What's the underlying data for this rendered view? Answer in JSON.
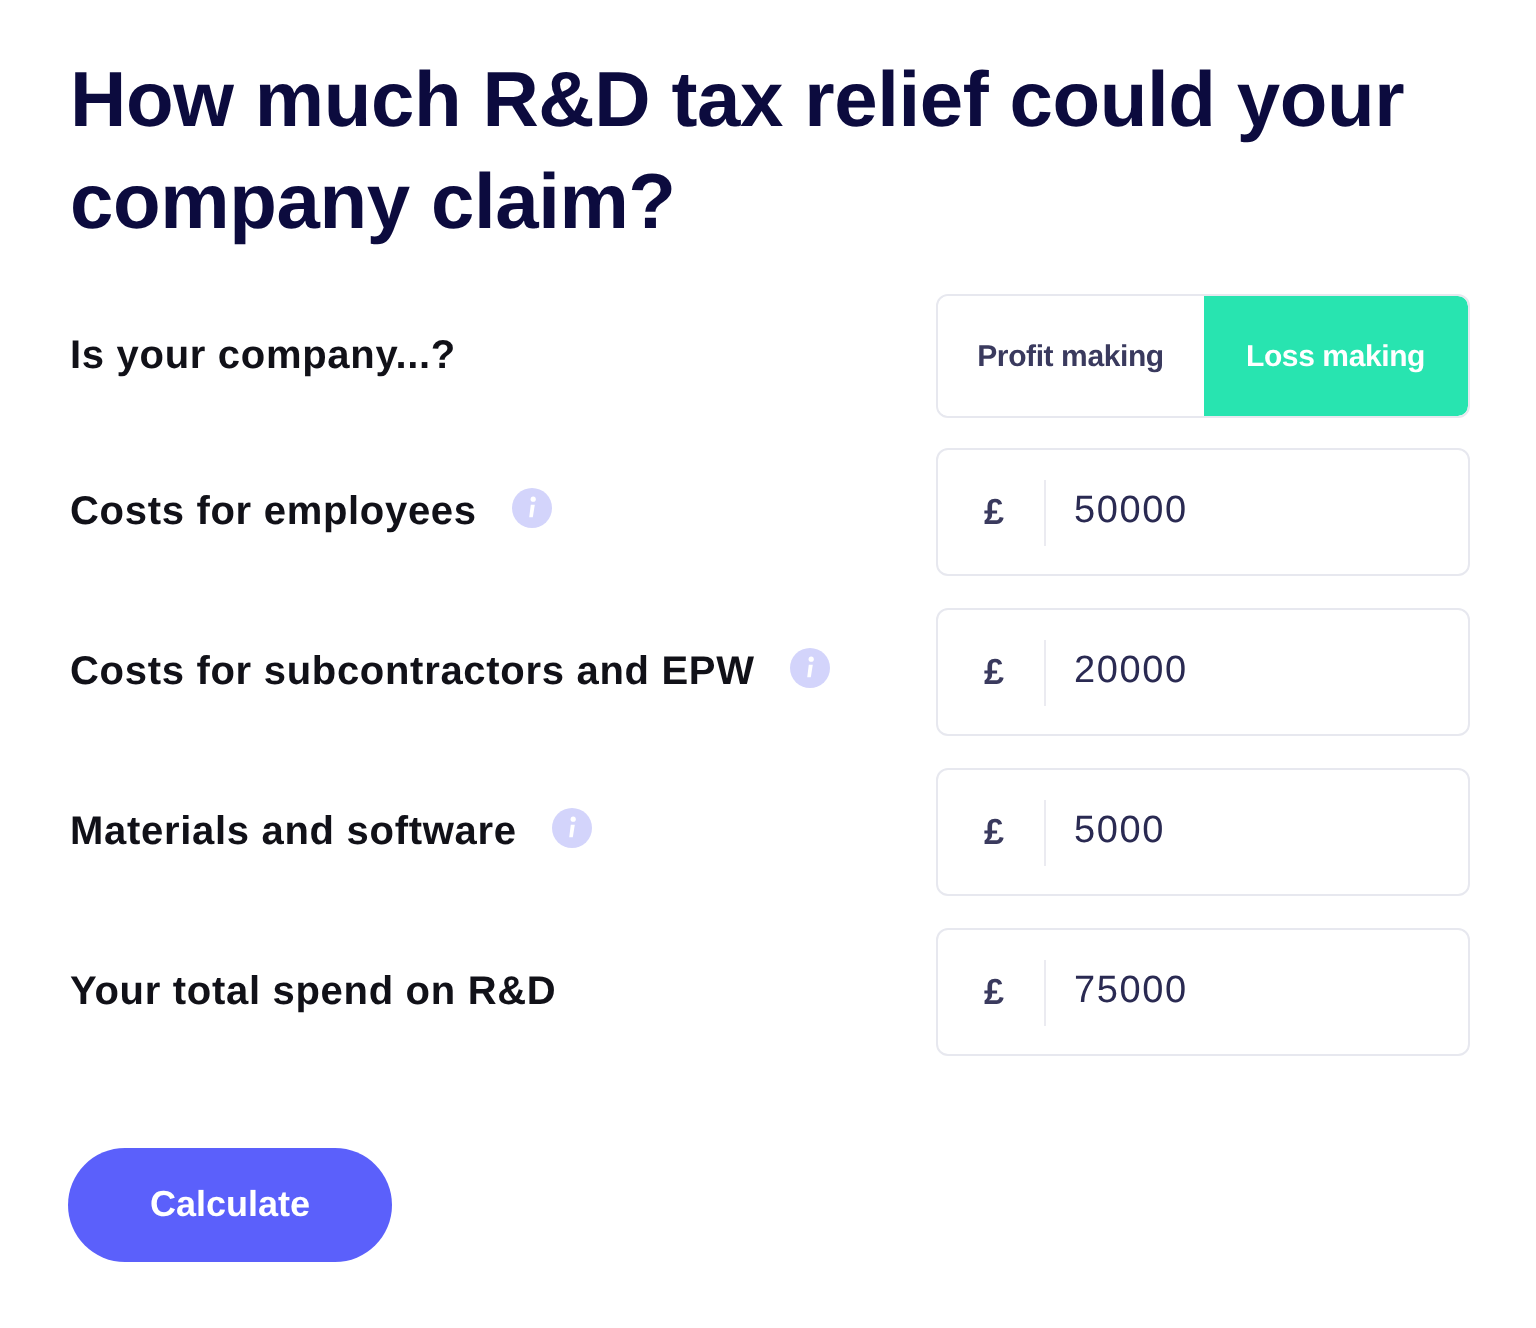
{
  "title": "How much R&D tax relief could your company claim?",
  "company_type": {
    "label": "Is your company...?",
    "options": [
      {
        "label": "Profit making",
        "selected": false
      },
      {
        "label": "Loss making",
        "selected": true
      }
    ]
  },
  "cost_fields": [
    {
      "label": "Costs for employees",
      "info": true,
      "currency": "£",
      "value": "50000"
    },
    {
      "label": "Costs for subcontractors and EPW",
      "info": true,
      "currency": "£",
      "value": "20000"
    },
    {
      "label": "Materials and software",
      "info": true,
      "currency": "£",
      "value": "5000"
    },
    {
      "label": "Your total spend on R&D",
      "info": false,
      "currency": "£",
      "value": "75000"
    }
  ],
  "calculate_button": {
    "label": "Calculate"
  }
}
